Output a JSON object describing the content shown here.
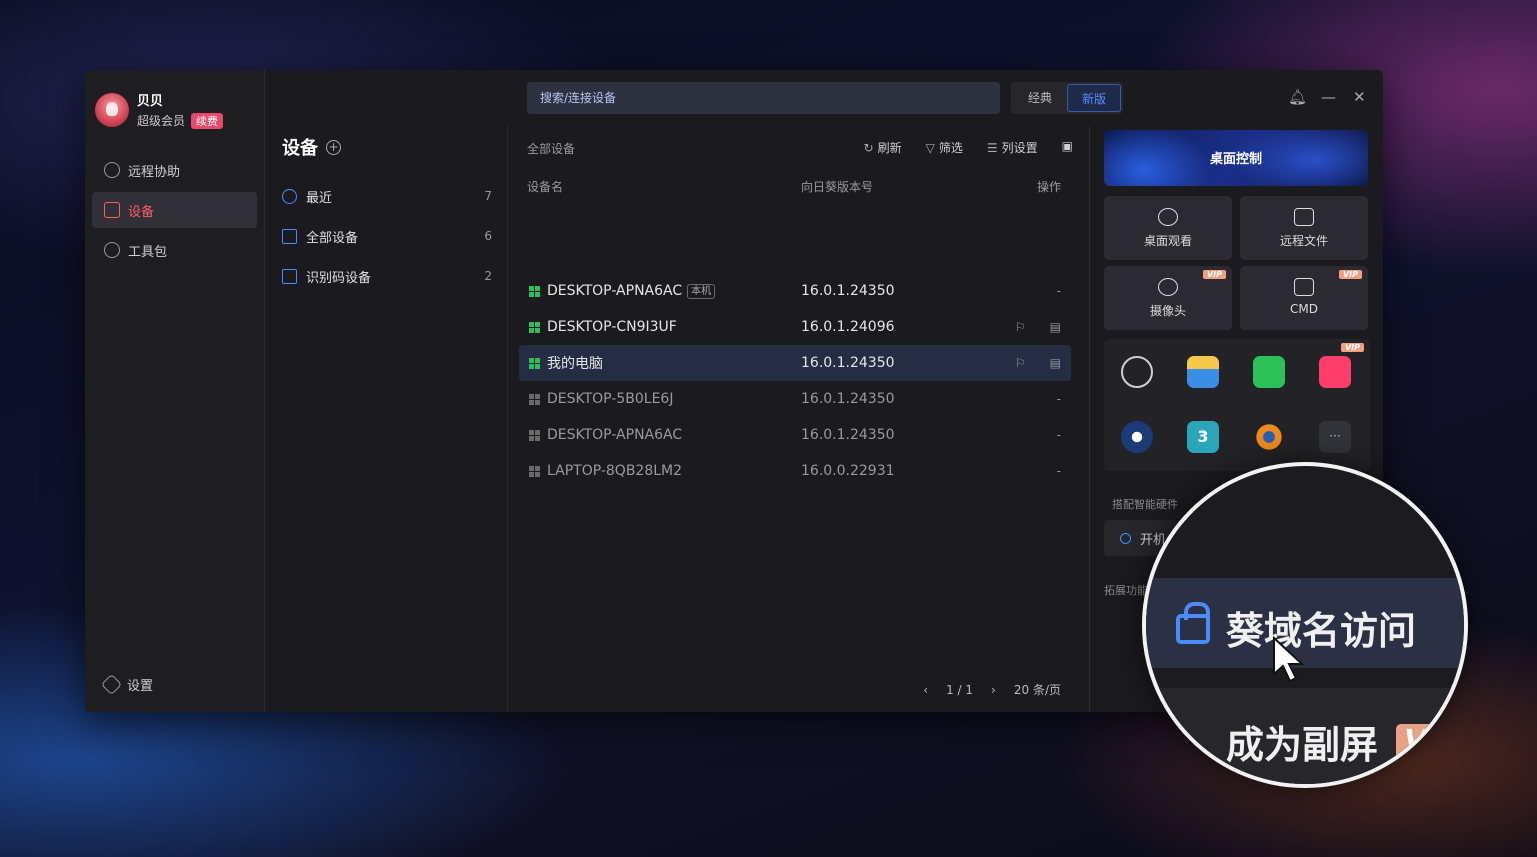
{
  "user": {
    "name": "贝贝",
    "membership": "超级会员",
    "renew_label": "续费"
  },
  "nav": {
    "items": [
      {
        "label": "远程协助",
        "icon": "remote-assist-icon"
      },
      {
        "label": "设备",
        "icon": "device-icon",
        "active": true
      },
      {
        "label": "工具包",
        "icon": "compass-icon"
      }
    ],
    "settings_label": "设置"
  },
  "groups": {
    "title": "设备",
    "items": [
      {
        "label": "最近",
        "count": "7",
        "icon": "clock-icon"
      },
      {
        "label": "全部设备",
        "count": "6",
        "icon": "monitor-icon"
      },
      {
        "label": "识别码设备",
        "count": "2",
        "icon": "id-code-icon"
      }
    ]
  },
  "topbar": {
    "search_placeholder": "搜索/连接设备",
    "mode_classic": "经典",
    "mode_new": "新版",
    "icons": [
      "bell-icon",
      "minimize-icon",
      "close-icon"
    ]
  },
  "devices": {
    "header": "全部设备",
    "tools": {
      "refresh": "刷新",
      "filter": "筛选",
      "columns": "列设置"
    },
    "columns": {
      "name": "设备名",
      "version": "向日葵版本号",
      "action": "操作"
    },
    "rows": [
      {
        "name": "DESKTOP-APNA6AC",
        "tag": "本机",
        "version": "16.0.1.24350",
        "action": "-",
        "online": true
      },
      {
        "name": "DESKTOP-CN9I3UF",
        "tag": "",
        "version": "16.0.1.24096",
        "action": "",
        "online": true
      },
      {
        "name": "我的电脑",
        "tag": "",
        "version": "16.0.1.24350",
        "action": "",
        "online": true,
        "selected": true
      },
      {
        "name": "DESKTOP-5B0LE6J",
        "tag": "",
        "version": "16.0.1.24350",
        "action": "-",
        "online": false
      },
      {
        "name": "DESKTOP-APNA6AC",
        "tag": "",
        "version": "16.0.1.24350",
        "action": "-",
        "online": false
      },
      {
        "name": "LAPTOP-8QB28LM2",
        "tag": "",
        "version": "16.0.0.22931",
        "action": "-",
        "online": false
      }
    ],
    "pager": {
      "prev": "‹",
      "page": "1",
      "sep": "/",
      "total": "1",
      "next": "›",
      "per_page": "20 条/页"
    }
  },
  "right_panel": {
    "hero_label": "桌面控制",
    "tiles": [
      {
        "label": "桌面观看",
        "icon": "eye-icon",
        "vip": false
      },
      {
        "label": "远程文件",
        "icon": "folder-transfer-icon",
        "vip": false
      },
      {
        "label": "摄像头",
        "icon": "camera-icon",
        "vip": true
      },
      {
        "label": "CMD",
        "icon": "cmd-icon",
        "vip": true
      }
    ],
    "vip_label": "VIP",
    "apps": [
      "obs-icon",
      "file-explorer-icon",
      "wechat-icon",
      "kuaishou-icon",
      "steam-icon",
      "3dsmax-icon",
      "blender-icon",
      "more-icon"
    ],
    "more_label": "···",
    "section_hardware": "搭配智能硬件",
    "power_label": "开机",
    "section_ext": "拓展功能"
  },
  "magnifier": {
    "line1": "葵域名访问",
    "line2": "成为副屏",
    "vip": "V"
  },
  "colors": {
    "accent": "#4a8cff",
    "active_nav": "#ff5a6e",
    "online": "#2fbf59",
    "vip": "#f1a183"
  }
}
